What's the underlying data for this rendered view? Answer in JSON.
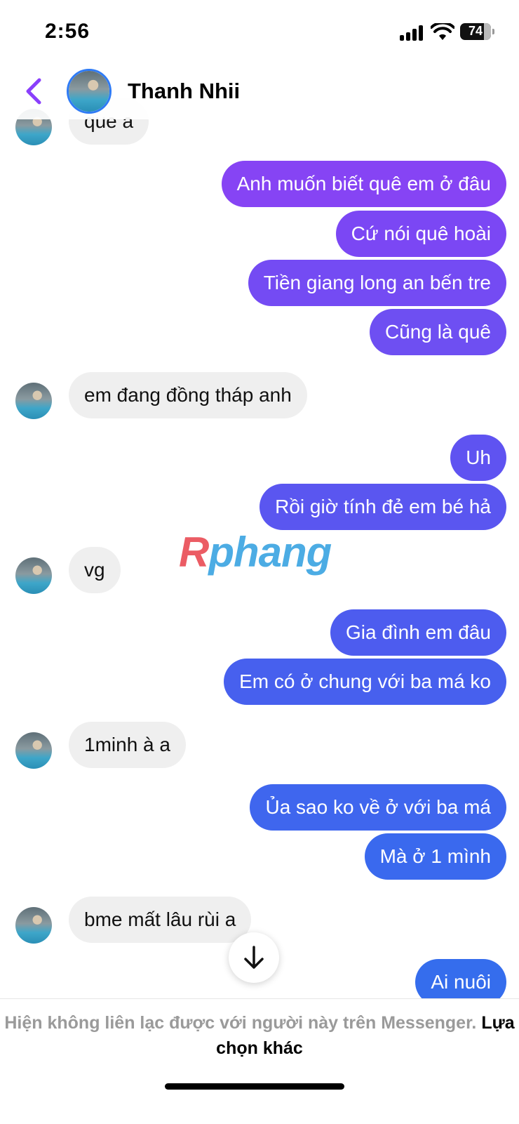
{
  "status": {
    "time": "2:56",
    "battery": "74"
  },
  "header": {
    "name": "Thanh Nhii",
    "back_icon": "chevron-left-icon",
    "accent": "#8a3ffc"
  },
  "messages": [
    {
      "side": "in",
      "text": "que a"
    },
    {
      "side": "out",
      "text": "Anh muốn biết quê em ở đâu",
      "color": "#8644f4"
    },
    {
      "side": "out",
      "text": "Cứ nói quê hoài",
      "color": "#7b47f4"
    },
    {
      "side": "out",
      "text": "Tiền giang long an bến tre",
      "color": "#744bf3"
    },
    {
      "side": "out",
      "text": "Cũng là quê",
      "color": "#6e4ff2"
    },
    {
      "side": "in",
      "text": "em đang đồng tháp anh"
    },
    {
      "side": "out",
      "text": "Uh",
      "color": "#5f53f1"
    },
    {
      "side": "out",
      "text": "Rồi giờ tính đẻ em bé hả",
      "color": "#5a56f0"
    },
    {
      "side": "in",
      "text": "vg"
    },
    {
      "side": "out",
      "text": "Gia đình em đâu",
      "color": "#4d5cef"
    },
    {
      "side": "out",
      "text": "Em có ở chung với ba má ko",
      "color": "#4760ee"
    },
    {
      "side": "in",
      "text": "1minh à a"
    },
    {
      "side": "out",
      "text": "Ủa sao ko về ở với ba má",
      "color": "#3f66ee"
    },
    {
      "side": "out",
      "text": "Mà ở 1 mình",
      "color": "#3a69ee"
    },
    {
      "side": "in",
      "text": "bme mất lâu rùi a"
    },
    {
      "side": "out",
      "text": "Ai nuôi",
      "color": "#356ded"
    }
  ],
  "watermark": {
    "first": "R",
    "rest": "phang"
  },
  "footer": {
    "notice": "Hiện không liên lạc được với người này trên Messenger.",
    "link": "Lựa chọn khác"
  }
}
